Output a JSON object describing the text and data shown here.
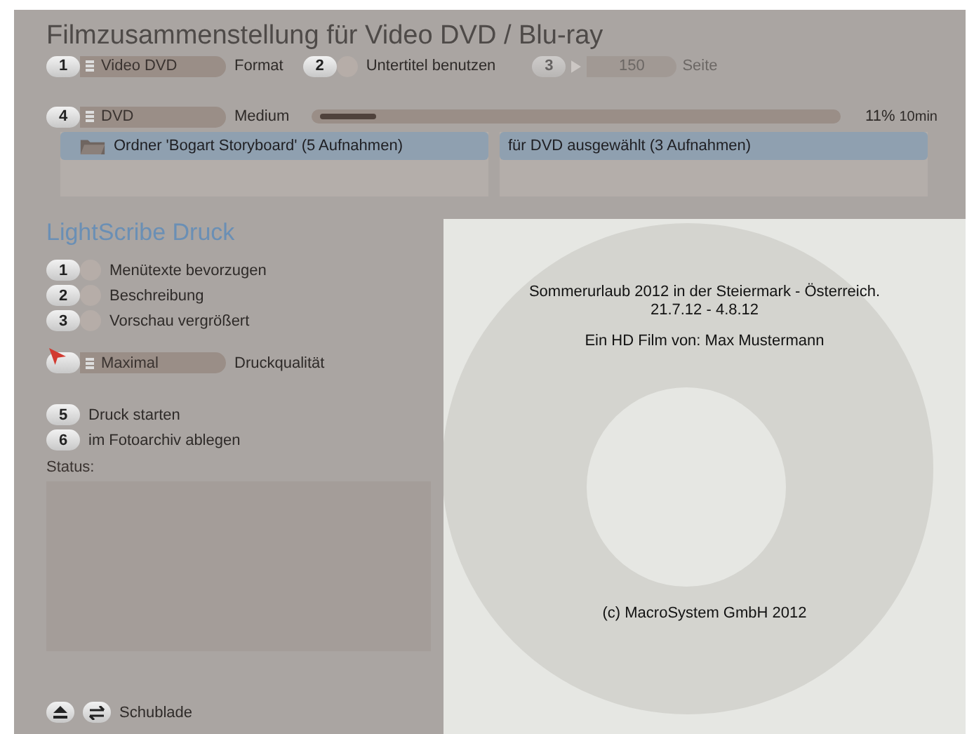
{
  "title": "Filmzusammenstellung für Video DVD / Blu-ray",
  "format_row": {
    "number": "1",
    "value": "Video DVD",
    "label": "Format"
  },
  "subtitle_option": {
    "number": "2",
    "label": "Untertitel benutzen",
    "checked": false
  },
  "page_option": {
    "number": "3",
    "value": "150",
    "label": "Seite",
    "disabled": true
  },
  "medium_row": {
    "number": "4",
    "value": "DVD",
    "label": "Medium",
    "level": 0.11,
    "reading": "11%",
    "duration": "10min"
  },
  "panels": [
    {
      "title": "Ordner 'Bogart Storyboard'  (5 Aufnahmen)",
      "kind": "folder"
    },
    {
      "title": "für DVD ausgewählt (3 Aufnahmen)",
      "kind": "plain"
    }
  ],
  "lightscribe": {
    "heading": "LightScribe Druck",
    "options": [
      {
        "number": "1",
        "label": "Menütexte bevorzugen",
        "checked": false
      },
      {
        "number": "2",
        "label": "Beschreibung",
        "checked": false
      },
      {
        "number": "3",
        "label": "Vorschau vergrößert",
        "checked": false
      }
    ],
    "quality": {
      "value": "Maximal",
      "label": "Druckqualität"
    },
    "actions": [
      {
        "number": "5",
        "label": "Druck starten"
      },
      {
        "number": "6",
        "label": "im Fotoarchiv ablegen"
      }
    ],
    "status_label": "Status:",
    "drawer_label": "Schublade"
  },
  "disc": {
    "lines": [
      "Sommerurlaub 2012 in der Steiermark - Österreich. 21.7.12 - 4.8.12",
      "Ein HD Film von: Max Mustermann"
    ],
    "footer": "(c) MacroSystem GmbH 2012"
  }
}
